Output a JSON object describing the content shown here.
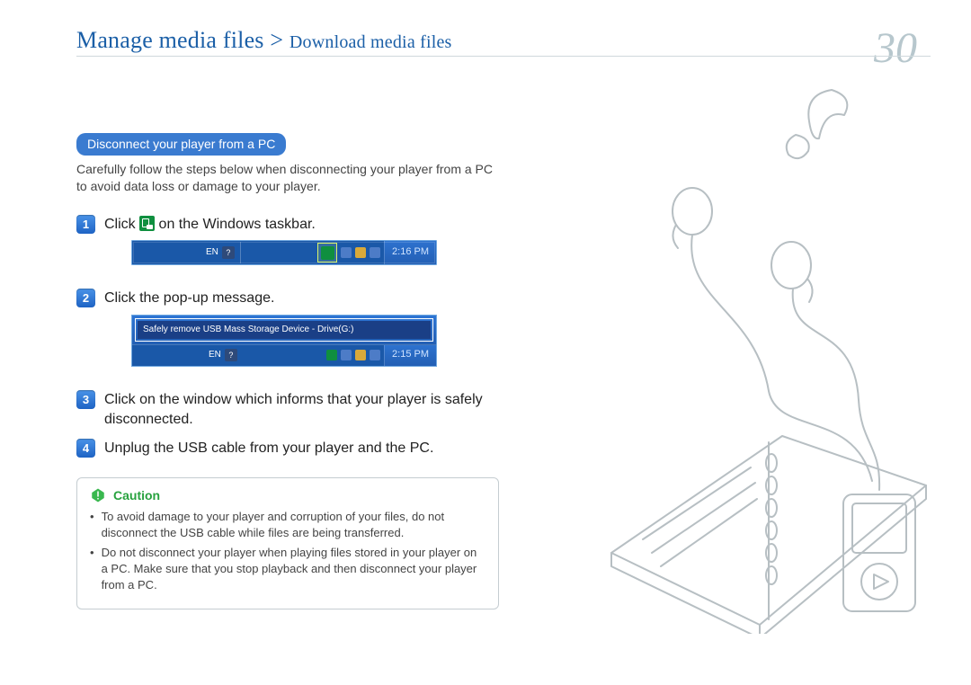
{
  "header": {
    "breadcrumb_main": "Manage media files",
    "breadcrumb_separator": " > ",
    "breadcrumb_sub": "Download media files",
    "page_number": "30"
  },
  "section": {
    "heading": "Disconnect your player from a PC",
    "intro": "Carefully follow the steps below when disconnecting your player from a PC to avoid data loss or damage to your player."
  },
  "steps": {
    "s1_pre": "Click ",
    "s1_post": " on the Windows taskbar.",
    "s2": "Click the pop-up message.",
    "s3": "Click on the window which informs that your player is safely disconnected.",
    "s4": "Unplug the USB cable from your player and the PC."
  },
  "taskbar1": {
    "lang": "EN",
    "clock": "2:16 PM"
  },
  "taskbar2": {
    "popup_text": "Safely remove USB Mass Storage Device - Drive(G:)",
    "lang": "EN",
    "clock": "2:15 PM"
  },
  "caution": {
    "label": "Caution",
    "items": [
      "To avoid damage to your player and corruption of your files, do not disconnect the USB cable while files are being transferred.",
      "Do not disconnect your player when playing files stored in your player on a PC. Make sure that you stop playback and then disconnect your player from a PC."
    ]
  }
}
